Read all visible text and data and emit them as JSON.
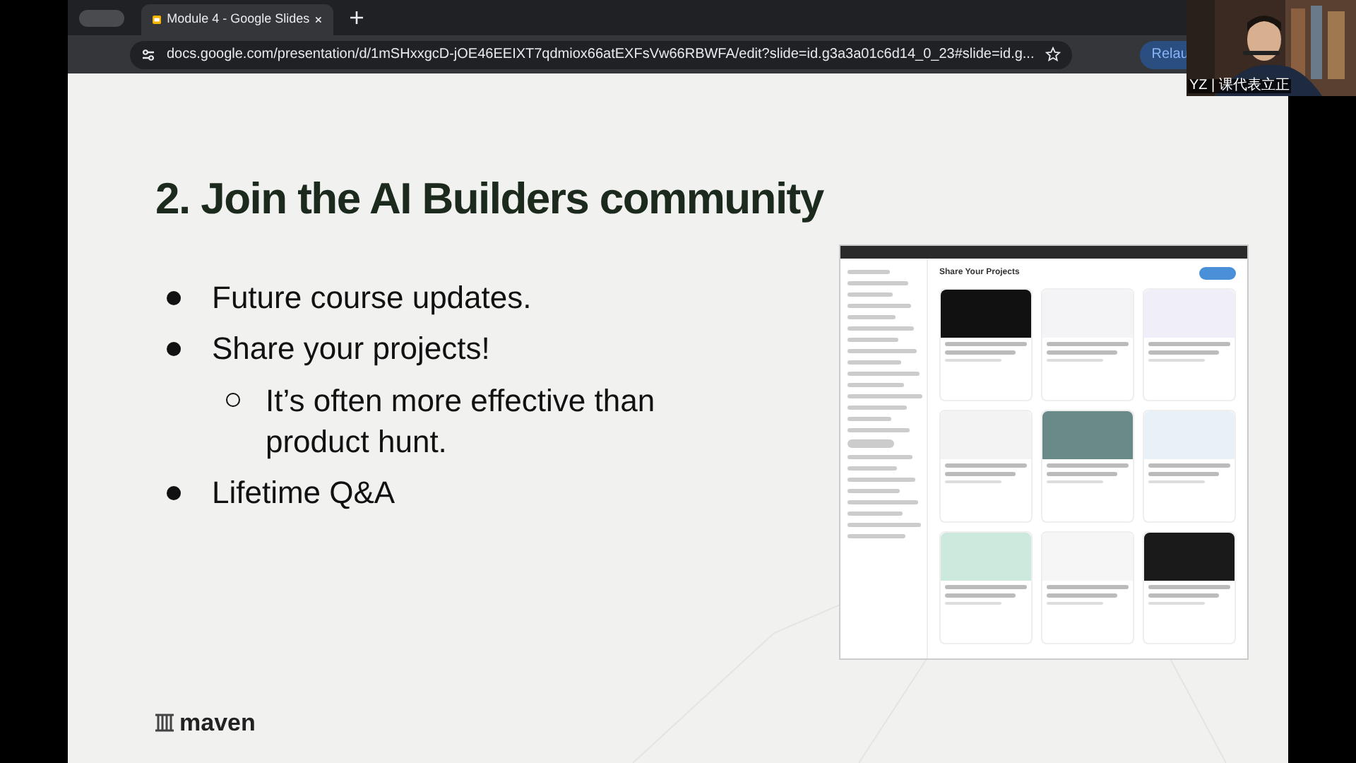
{
  "browser": {
    "tab": {
      "title": "Module 4 - Google Slides"
    },
    "url": "docs.google.com/presentation/d/1mSHxxgcD-jOE46EEIXT7qdmiox66atEXFsVw66RBWFA/edit?slide=id.g3a3a01c6d14_0_23#slide=id.g...",
    "relaunch": "Relau"
  },
  "webcam": {
    "kind": "picture",
    "caption": "YZ | 课代表立正"
  },
  "slide": {
    "title": "2. Join the AI Builders community",
    "bullets": [
      {
        "text": "Future course updates."
      },
      {
        "text": "Share your projects!",
        "children": [
          {
            "text": "It’s often more effective than product hunt."
          }
        ]
      },
      {
        "text": "Lifetime Q&A"
      }
    ],
    "screenshot": {
      "heading": "Share Your Projects"
    },
    "logo": "maven"
  }
}
